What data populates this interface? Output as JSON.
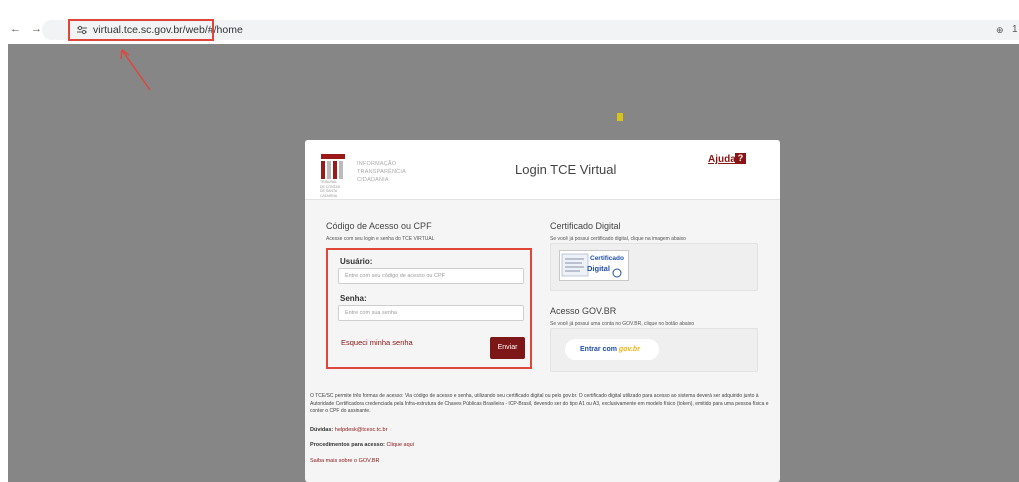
{
  "browser": {
    "back_icon": "←",
    "forward_icon": "→",
    "reload_icon": "C",
    "url": "virtual.tce.sc.gov.br/web/#/home",
    "right_icon": "⊕",
    "right_label": "1"
  },
  "header": {
    "logo_letters": [
      "INFORMAÇÃO",
      "TRANSPARÊNCIA",
      "CIDADANIA"
    ],
    "logo_side": [
      "TRIBUNAL",
      "DE CONTAS",
      "DE SANTA",
      "CATARINA"
    ],
    "title": "Login TCE Virtual",
    "help_label": "Ajuda",
    "help_icon": "?"
  },
  "login": {
    "title": "Código de Acesso ou CPF",
    "subtitle": "Acesse com seu login e senha do TCE VIRTUAL",
    "user_label": "Usuário:",
    "user_placeholder": "Entre com seu código de acesso ou CPF",
    "pass_label": "Senha:",
    "pass_placeholder": "Entre com sua senha",
    "forgot_label": "Esqueci minha senha",
    "submit_label": "Enviar"
  },
  "certificate": {
    "title": "Certificado Digital",
    "subtitle": "Se você já possui certificado digital, clique na imagem abaixo",
    "image_text_1": "Certificado",
    "image_text_2": "Digital"
  },
  "govbr": {
    "title": "Acesso GOV.BR",
    "subtitle": "Se você já possui uma conta no GOV.BR, clique no botão abaixo",
    "button_prefix": "Entrar com",
    "button_brand": "gov.br"
  },
  "footer": {
    "description": "O TCE/SC permite três formas de acesso: Via código de acesso e senha, utilizando seu certificado digital ou pelo gov.br. O certificado digital utilizado para acesso ao sistema deverá ser adquirido junto à Autoridade Certificadora credenciada pela Infra-estrutura de Chaves Públicas Brasileira - ICP-Brasil, devendo ser do tipo A1 ou A3, exclusivamente em modelo físico (token), emitido para uma pessoa física e conter o CPF do assinante.",
    "doubts_label": "Dúvidas:",
    "doubts_email": "helpdesk@tcesc.tc.br",
    "procedures_label": "Procedimentos para acesso:",
    "procedures_link": "Clique aqui",
    "govbr_link": "Saiba mais sobre o GOV.BR"
  },
  "colors": {
    "accent": "#8a1515",
    "annotation": "#e0453a",
    "background": "#868686"
  }
}
